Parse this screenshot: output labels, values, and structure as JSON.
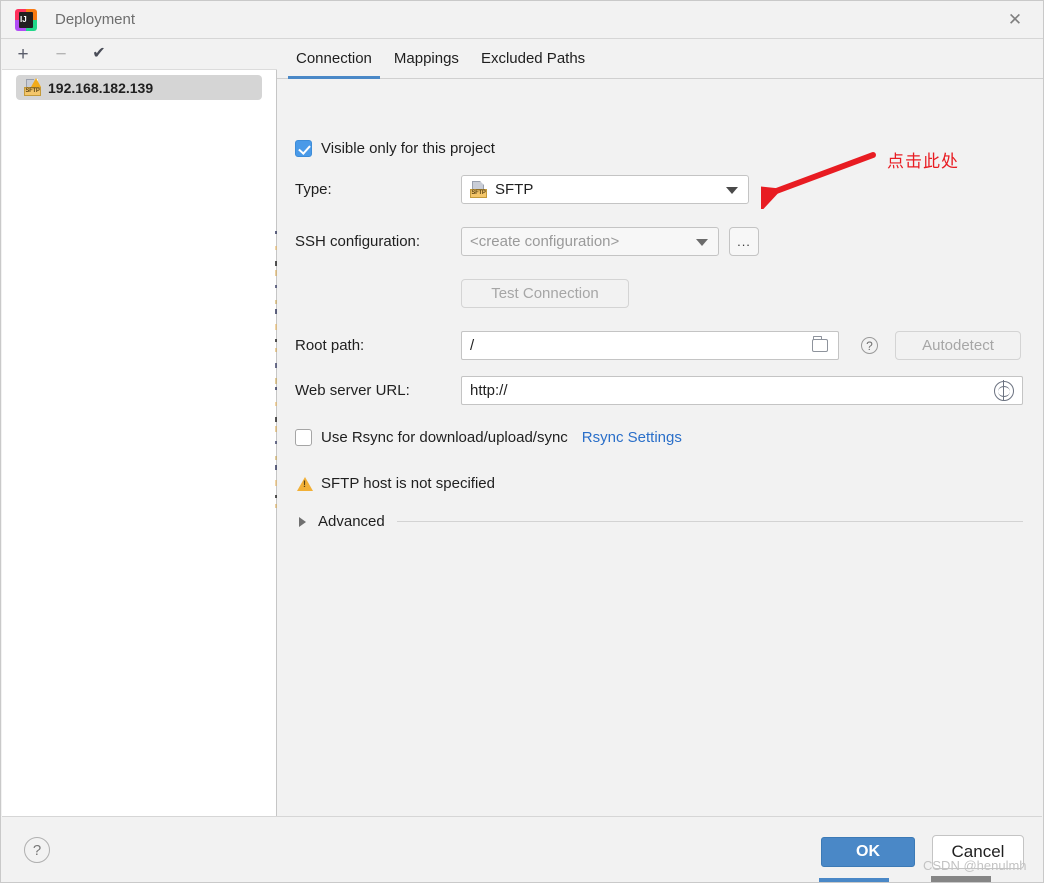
{
  "window": {
    "title": "Deployment",
    "close_icon": "close-icon"
  },
  "sidebar": {
    "toolbar": [
      {
        "name": "add",
        "glyph": "+"
      },
      {
        "name": "remove",
        "glyph": "−"
      },
      {
        "name": "set-default",
        "glyph": "✔"
      }
    ],
    "servers": [
      {
        "label": "192.168.182.139",
        "icon": "sftp-warning-icon",
        "selected": true
      }
    ]
  },
  "tabs": [
    {
      "label": "Connection",
      "active": true
    },
    {
      "label": "Mappings",
      "active": false
    },
    {
      "label": "Excluded Paths",
      "active": false
    }
  ],
  "form": {
    "visible_only": {
      "label": "Visible only for this project",
      "checked": true
    },
    "type": {
      "label": "Type:",
      "value": "SFTP",
      "icon": "sftp-icon"
    },
    "ssh_configuration": {
      "label": "SSH configuration:",
      "value": "<create configuration>",
      "is_placeholder": true,
      "browse_label": "..."
    },
    "test_connection": {
      "label": "Test Connection",
      "disabled": true
    },
    "root_path": {
      "label": "Root path:",
      "value": "/",
      "folder_icon": "folder-icon",
      "help_icon": "question-mark-icon",
      "autodetect_label": "Autodetect",
      "autodetect_disabled": true
    },
    "web_server_url": {
      "label": "Web server URL:",
      "value": "http://",
      "globe_icon": "globe-icon"
    },
    "rsync": {
      "checkbox_label": "Use Rsync for download/upload/sync",
      "checked": false,
      "settings_link": "Rsync Settings"
    },
    "warning": {
      "text": "SFTP host is not specified",
      "icon": "warning-triangle-icon"
    },
    "advanced": {
      "label": "Advanced",
      "expanded": false,
      "icon": "chevron-right-icon"
    }
  },
  "annotation": {
    "text": "点击此处",
    "color": "#e81c22",
    "arrow_icon": "red-arrow-icon"
  },
  "footer": {
    "help_label": "?",
    "ok_label": "OK",
    "cancel_label": "Cancel"
  },
  "watermark": {
    "text": "CSDN @henulmh"
  },
  "colors": {
    "accent": "#4a88c7",
    "annotation_red": "#e81c22",
    "link_blue": "#2a6fc9",
    "warning_amber": "#f2b036"
  }
}
